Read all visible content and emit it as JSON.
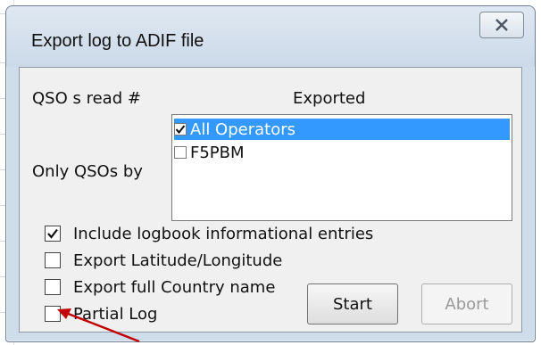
{
  "window": {
    "title": "Export log to ADIF file"
  },
  "dialog": {
    "qso_read_label": "QSO s read #",
    "exported_label": "Exported",
    "only_qsos_by_label": "Only QSOs by",
    "operators": [
      {
        "label": "All Operators",
        "checked": true,
        "selected": true
      },
      {
        "label": "F5PBM",
        "checked": false,
        "selected": false
      }
    ],
    "options": [
      {
        "label": "Include logbook informational entries",
        "checked": true
      },
      {
        "label": "Export Latitude/Longitude",
        "checked": false
      },
      {
        "label": "Export full Country name",
        "checked": false
      },
      {
        "label": "Partial Log",
        "checked": false
      }
    ],
    "start_label": "Start",
    "abort_label": "Abort"
  },
  "colors": {
    "selection": "#3399ff",
    "annotation_arrow": "#c00000"
  }
}
